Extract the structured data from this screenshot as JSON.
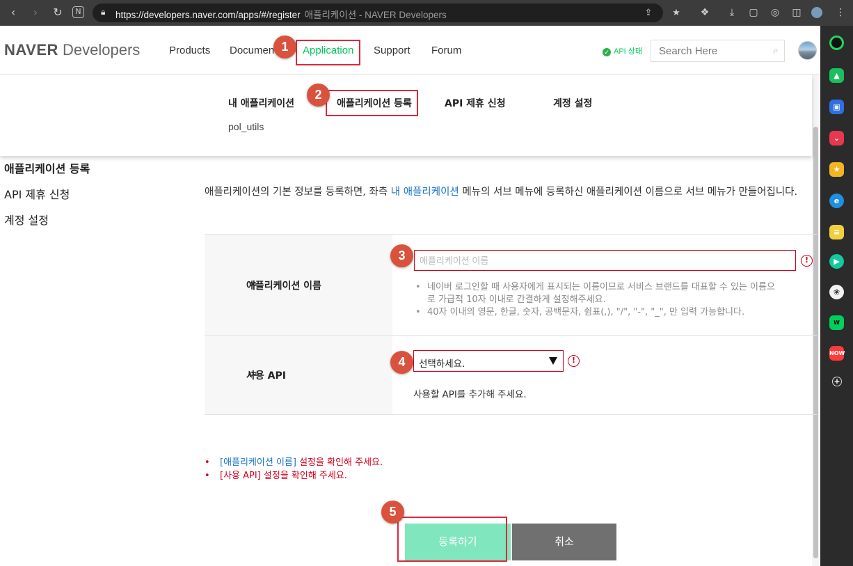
{
  "browser": {
    "url": "https://developers.naver.com/apps/#/register",
    "page_title": "애플리케이션 - NAVER Developers",
    "nav_icons": [
      "back-icon",
      "forward-icon",
      "reload-icon",
      "notion-icon"
    ],
    "url_icons": [
      "share-icon",
      "favorites-icon"
    ],
    "toolbar_icons": [
      "extensions-icon",
      "download-icon",
      "screen-record-icon",
      "screenshot-icon",
      "split-view-icon",
      "profile-icon",
      "more-icon"
    ]
  },
  "sidebar_apps": [
    {
      "name": "green-app-icon",
      "color": "#111111"
    },
    {
      "name": "notification-app-icon",
      "color": "#1bbf5f"
    },
    {
      "name": "briefcase-app-icon",
      "color": "#2f6fe3"
    },
    {
      "name": "pocket-app-icon",
      "color": "#e8384f"
    },
    {
      "name": "star-app-icon",
      "color": "#f3b623"
    },
    {
      "name": "edge-app-icon",
      "color": "#1f8fe0"
    },
    {
      "name": "notes-app-icon",
      "color": "#f1d040"
    },
    {
      "name": "play-app-icon",
      "color": "#16c7a0"
    },
    {
      "name": "chatgpt-app-icon",
      "color": "#f2f2f2"
    },
    {
      "name": "webtoon-app-icon",
      "color": "#00cf5d"
    },
    {
      "name": "now-app-icon",
      "color": "#ff3a3a"
    },
    {
      "name": "add-app-icon",
      "color": "#2b2b2b"
    }
  ],
  "header": {
    "logo_bold": "NAVER",
    "logo_light": " Developers",
    "nav": [
      "Products",
      "Documen",
      "Application",
      "Support",
      "Forum"
    ],
    "active_nav": "Application",
    "api_status": "API 상태",
    "search_placeholder": "Search Here"
  },
  "submenu": {
    "items": [
      "내 애플리케이션",
      "애플리케이션 등록",
      "API 제휴 신청",
      "계정 설정"
    ],
    "sub_item": "pol_utils"
  },
  "lnb": {
    "items": [
      "애플리케이션 등록",
      "API 제휴 신청",
      "계정 설정"
    ]
  },
  "main": {
    "desc_prefix": "애플리케이션의 기본 정보를 등록하면, 좌측 ",
    "desc_link": "내 애플리케이션",
    "desc_suffix": " 메뉴의 서브 메뉴에 등록하신 애플리케이션 이름으로 서브 메뉴가 만들어집니다.",
    "app_name_label": "애플리케이션 이름",
    "app_name_placeholder": "애플리케이션 이름",
    "app_name_hints": [
      "네이버 로그인할 때 사용자에게 표시되는 이름이므로 서비스 브랜드를 대표할 수 있는 이름으로 가급적 10자 이내로 간결하게 설정해주세요.",
      "40자 이내의 영문, 한글, 숫자, 공백문자, 쉼표(,), \"/\", \"-\", \"_\", 만 입력 가능합니다."
    ],
    "api_label": "사용 API",
    "api_select": "선택하세요.",
    "api_hint": "사용할 API를 추가해 주세요.",
    "errors": [
      {
        "link": "[애플리케이션 이름]",
        "text": " 설정을 확인해 주세요."
      },
      {
        "link": "[사용 API]",
        "text": " 설정을 확인해 주세요."
      }
    ],
    "submit_label": "등록하기",
    "cancel_label": "취소"
  },
  "annotations": [
    "1",
    "2",
    "3",
    "4",
    "5"
  ],
  "colors": {
    "accent_green": "#03c75a",
    "error_red": "#d0021b",
    "link_blue": "#1a73c8",
    "submit_bg": "#7fe6bd",
    "cancel_bg": "#707070",
    "marker": "#d9523e"
  }
}
